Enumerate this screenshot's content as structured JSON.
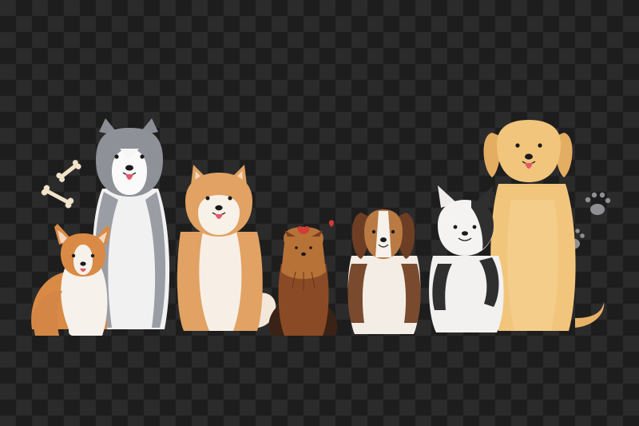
{
  "illustration": {
    "checker_colors": [
      "#2b2b2b",
      "#1d1d1d"
    ],
    "subjects": [
      {
        "name": "corgi-dog",
        "colors": [
          "#d98a45",
          "#f5f0ea"
        ]
      },
      {
        "name": "husky-dog",
        "colors": [
          "#8e9197",
          "#f2f2f2"
        ]
      },
      {
        "name": "shiba-dog",
        "colors": [
          "#e0a060",
          "#f6efe6"
        ]
      },
      {
        "name": "yorkshire-terrier-dog",
        "colors": [
          "#8a4a26",
          "#c98a4e"
        ]
      },
      {
        "name": "beagle-dog",
        "colors": [
          "#7a4a2e",
          "#f3ece4"
        ]
      },
      {
        "name": "french-bulldog-dog",
        "colors": [
          "#f1efee",
          "#2e2e2e"
        ]
      },
      {
        "name": "golden-retriever-dog",
        "colors": [
          "#f1c57c",
          "#e6b067"
        ]
      }
    ],
    "decorations": [
      "bone-icon",
      "bone-icon",
      "heart-icon",
      "paw-print-icon",
      "paw-print-icon"
    ]
  }
}
